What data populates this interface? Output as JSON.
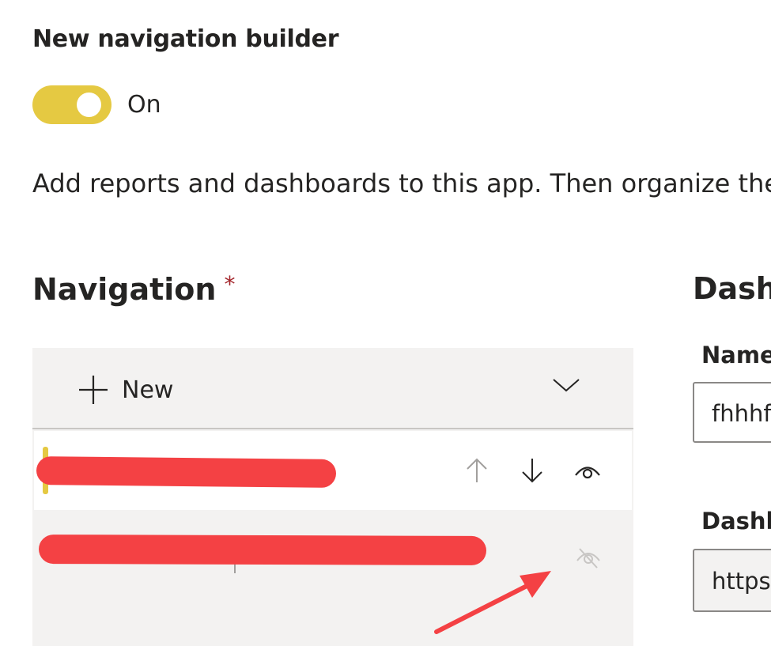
{
  "builder": {
    "title": "New navigation builder",
    "toggle_state": "On",
    "accent_color": "#e5c942"
  },
  "description": "Add reports and dashboards to this app. Then organize the c",
  "navigation": {
    "heading": "Navigation",
    "required_mark": "*",
    "new_label": "New",
    "new_icon": "plus-icon",
    "dropdown_icon": "chevron-down-icon",
    "items": [
      {
        "selected": true,
        "redacted": true,
        "redaction_color": "#f44144",
        "icons": [
          "arrow-up-icon",
          "arrow-down-icon",
          "eye-icon"
        ]
      },
      {
        "selected": false,
        "redacted": true,
        "redaction_color": "#f44144",
        "icons": [
          "eye-hidden-icon"
        ]
      }
    ]
  },
  "details": {
    "heading": "Dashb",
    "name_label": "Name",
    "name_value": "fhhhf",
    "url_label": "Dashb",
    "url_value": "https"
  },
  "annotation": {
    "arrow_color": "#f44144",
    "arrow_target": "eye-hidden-icon"
  }
}
